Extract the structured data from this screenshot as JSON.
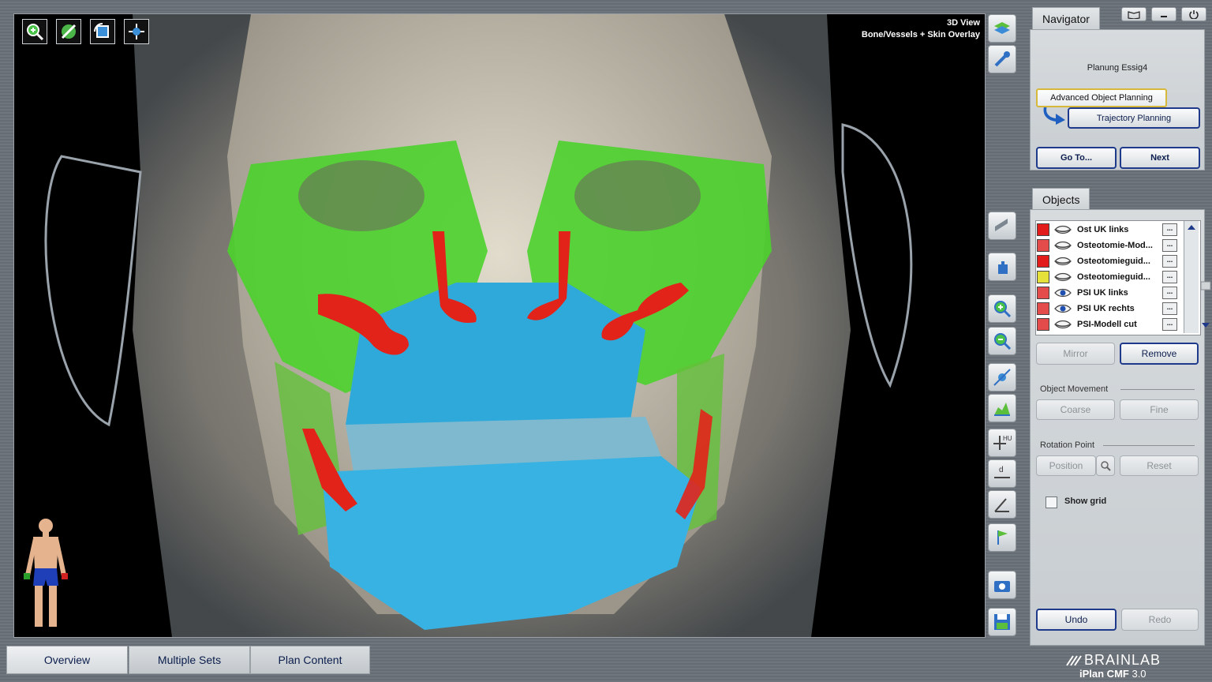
{
  "viewport": {
    "title_line1": "3D View",
    "title_line2": "Bone/Vessels + Skin Overlay"
  },
  "top_tools": [
    {
      "icon": "zoom-fit-icon"
    },
    {
      "icon": "adjust-icon"
    },
    {
      "icon": "rotate-icon"
    },
    {
      "icon": "pan-icon"
    }
  ],
  "navigator": {
    "tab_label": "Navigator",
    "plan_name": "Planung Essig4",
    "current_step": "Advanced Object Planning",
    "next_step": "Trajectory Planning",
    "goto_label": "Go To...",
    "next_label": "Next"
  },
  "objects": {
    "tab_label": "Objects",
    "items": [
      {
        "color": "#e21b1b",
        "visible": false,
        "name": "Ost UK links"
      },
      {
        "color": "#e44b4b",
        "visible": false,
        "name": "Osteotomie-Mod..."
      },
      {
        "color": "#e21b1b",
        "visible": false,
        "name": "Osteotomieguid..."
      },
      {
        "color": "#e6e03a",
        "visible": false,
        "name": "Osteotomieguid..."
      },
      {
        "color": "#e44b4b",
        "visible": true,
        "name": "PSI UK links"
      },
      {
        "color": "#e44b4b",
        "visible": true,
        "name": "PSI UK rechts"
      },
      {
        "color": "#e44b4b",
        "visible": false,
        "name": "PSI-Modell cut"
      }
    ],
    "dots_label": "...",
    "mirror_label": "Mirror",
    "remove_label": "Remove",
    "movement_label": "Object Movement",
    "coarse_label": "Coarse",
    "fine_label": "Fine",
    "rotation_label": "Rotation Point",
    "position_label": "Position",
    "reset_label": "Reset",
    "grid_label": "Show grid",
    "grid_checked": false,
    "undo_label": "Undo",
    "redo_label": "Redo"
  },
  "bottom_tabs": [
    "Overview",
    "Multiple Sets",
    "Plan Content"
  ],
  "brand": {
    "name": "BRAINLAB",
    "product": "iPlan CMF",
    "version": "3.0"
  }
}
